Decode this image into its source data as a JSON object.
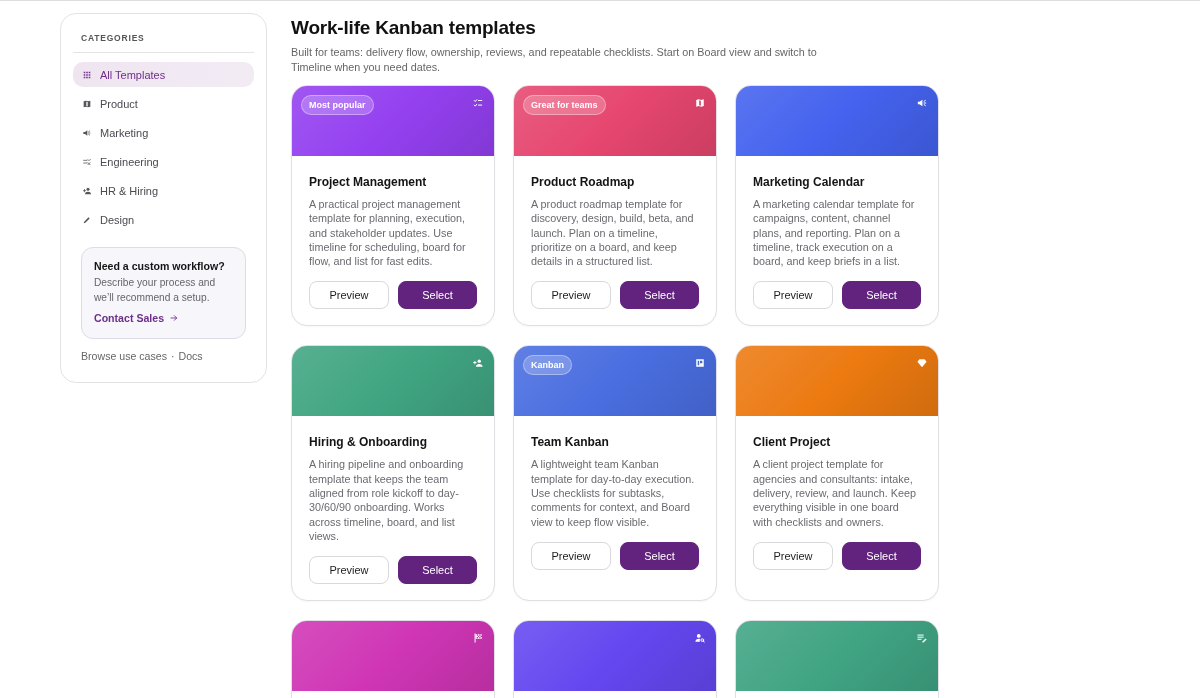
{
  "sidebar": {
    "heading": "CATEGORIES",
    "items": [
      {
        "label": "All Templates",
        "selected": true
      },
      {
        "label": "Product",
        "selected": false
      },
      {
        "label": "Marketing",
        "selected": false
      },
      {
        "label": "Engineering",
        "selected": false
      },
      {
        "label": "HR & Hiring",
        "selected": false
      },
      {
        "label": "Design",
        "selected": false
      }
    ],
    "promo": {
      "title": "Need a custom workflow?",
      "text": "Describe your process and we’ll recommend a setup.",
      "link": "Contact Sales"
    },
    "footer_links": [
      "Browse use cases",
      "Docs"
    ],
    "footer_separator": "·"
  },
  "page": {
    "title": "Work-life Kanban templates",
    "subtitle": "Built for teams: delivery flow, ownership, reviews, and repeatable checklists. Start on Board view and switch to Timeline when you need dates."
  },
  "cards": [
    {
      "color": "#9440f0",
      "badge": "Most popular",
      "title": "Project Management",
      "description": "A practical project management template for planning, execution, and stakeholder updates. Use timeline for scheduling, board for flow, and list for fast edits.",
      "actions": [
        {
          "label": "Preview",
          "kind": "secondary"
        },
        {
          "label": "Select",
          "kind": "primary"
        }
      ]
    },
    {
      "color": "#e6466f",
      "badge": "Great for teams",
      "title": "Product Roadmap",
      "description": "A product roadmap template for discovery, design, build, beta, and launch. Plan on a timeline, prioritize on a board, and keep details in a structured list.",
      "actions": [
        {
          "label": "Preview",
          "kind": "secondary"
        },
        {
          "label": "Select",
          "kind": "primary"
        }
      ]
    },
    {
      "color": "#4462ee",
      "title": "Marketing Calendar",
      "description": "A marketing calendar template for campaigns, content, channel plans, and reporting. Plan on a timeline, track execution on a board, and keep briefs in a list.",
      "actions": [
        {
          "label": "Preview",
          "kind": "secondary"
        },
        {
          "label": "Select",
          "kind": "primary"
        }
      ]
    },
    {
      "color": "#40a582",
      "title": "Hiring & Onboarding",
      "description": "A hiring pipeline and onboarding template that keeps the team aligned from role kickoff to day-30/60/90 onboarding. Works across timeline, board, and list views.",
      "actions": [
        {
          "label": "Preview",
          "kind": "secondary"
        },
        {
          "label": "Select",
          "kind": "primary"
        }
      ]
    },
    {
      "color": "#4a6ee0",
      "badge": "Kanban",
      "title": "Team Kanban",
      "description": "A lightweight team Kanban template for day-to-day execution. Use checklists for subtasks, comments for context, and Board view to keep flow visible.",
      "actions": [
        {
          "label": "Preview",
          "kind": "secondary"
        },
        {
          "label": "Select",
          "kind": "primary"
        }
      ]
    },
    {
      "color": "#ec7a10",
      "title": "Client Project",
      "description": "A client project template for agencies and consultants: intake, delivery, review, and launch. Keep everything visible in one board with checklists and owners.",
      "actions": [
        {
          "label": "Preview",
          "kind": "secondary"
        },
        {
          "label": "Select",
          "kind": "primary"
        }
      ]
    },
    {
      "color": "#cf35b5"
    },
    {
      "color": "#6547f0"
    },
    {
      "color": "#40a483"
    }
  ]
}
